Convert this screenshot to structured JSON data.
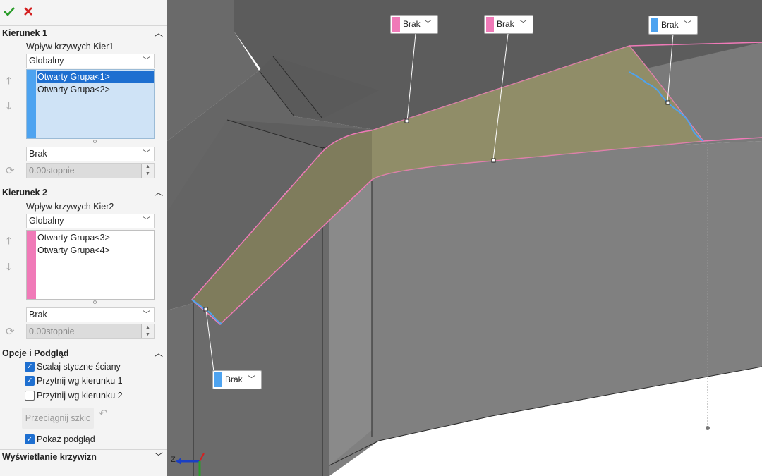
{
  "toolbar": {
    "ok_icon": "checkmark-icon",
    "cancel_icon": "close-icon",
    "ok_color": "#2a9d2a",
    "cancel_color": "#d42020"
  },
  "dir1": {
    "title": "Kierunek 1",
    "influence_label": "Wpływ krzywych Kier1",
    "scope_value": "Globalny",
    "swatch_color": "#4da3f0",
    "items": [
      "Otwarty Grupa<1>",
      "Otwarty Grupa<2>"
    ],
    "selected_index": 0,
    "condition_value": "Brak",
    "angle_value": "0.00stopnie"
  },
  "dir2": {
    "title": "Kierunek 2",
    "influence_label": "Wpływ krzywych Kier2",
    "scope_value": "Globalny",
    "swatch_color": "#f07ab8",
    "items": [
      "Otwarty Grupa<3>",
      "Otwarty Grupa<4>"
    ],
    "condition_value": "Brak",
    "angle_value": "0.00stopnie"
  },
  "options": {
    "title": "Opcje i Podgląd",
    "merge_tangent": {
      "label": "Scalaj styczne ściany",
      "checked": true
    },
    "trim_dir1": {
      "label": "Przytnij wg kierunku 1",
      "checked": true
    },
    "trim_dir2": {
      "label": "Przytnij wg kierunku 2",
      "checked": false
    },
    "drag_sketch_label": "Przeciągnij szkic",
    "show_preview": {
      "label": "Pokaż podgląd",
      "checked": true
    }
  },
  "curvature": {
    "title": "Wyświetlanie krzywizn"
  },
  "viewport": {
    "callouts": [
      {
        "label": "Brak",
        "color": "#f07ab8"
      },
      {
        "label": "Brak",
        "color": "#f07ab8"
      },
      {
        "label": "Brak",
        "color": "#4da3f0"
      },
      {
        "label": "Brak",
        "color": "#4da3f0"
      }
    ],
    "triad_axis_label": "Z"
  }
}
